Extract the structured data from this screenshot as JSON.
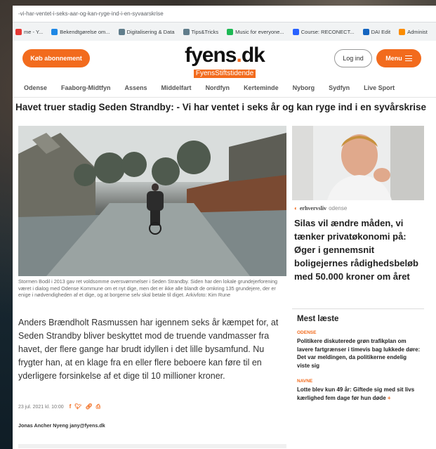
{
  "browser": {
    "url": "-vi-har-ventet-i-seks-aar-og-kan-ryge-ind-i-en-syvaarskrise",
    "bookmarks": [
      {
        "label": "me - Y...",
        "color": "#e53935"
      },
      {
        "label": "Bekendtgørelse om...",
        "color": "#1e88e5"
      },
      {
        "label": "Digitalisering & Data",
        "color": "#607d8b"
      },
      {
        "label": "Tips&Tricks",
        "color": "#607d8b"
      },
      {
        "label": "Music for everyone...",
        "color": "#1db954"
      },
      {
        "label": "Course: RECONECT...",
        "color": "#2962ff"
      },
      {
        "label": "DAI Edit",
        "color": "#1565c0"
      },
      {
        "label": "Administ",
        "color": "#fb8c00"
      }
    ]
  },
  "header": {
    "subscribe_label": "Køb abonnement",
    "logo_main": "fyens",
    "logo_dot": ".",
    "logo_tld": "dk",
    "logo_sub": "FyensStiftstidende",
    "login_label": "Log ind",
    "menu_label": "Menu"
  },
  "nav": [
    "Odense",
    "Faaborg-Midtfyn",
    "Assens",
    "Middelfart",
    "Nordfyn",
    "Kerteminde",
    "Nyborg",
    "Sydfyn",
    "Live Sport"
  ],
  "article": {
    "headline": "Havet truer stadig Seden Strandby: - Vi har ventet i seks år og kan ryge ind i en syvårskrise",
    "caption": "Stormen Bodil i 2013 gav ret voldsomme oversvømmelser i Seden Strandby. Siden har den lokale grundejerforening været i dialog med Odense Kommune om et nyt dige, men det er ikke alle blandt de omkring 135 grundejere, der er enige i nødvendigheden af et dige, og at borgerne selv skal betale til diget. Arkivfoto: Kim Rune",
    "lead": "Anders Brændholt Rasmussen har igennem seks år kæmpet for, at Seden Strandby bliver beskyttet mod de truende vandmasser fra havet, der flere gange har brudt idyllen i det lille bysamfund. Nu frygter han, at en klage fra en eller flere beboere kan føre til en yderligere forsinkelse af et dige til 10 millioner kroner.",
    "date": "23 jul. 2021 kl. 10:00",
    "byline": "Jonas Ancher Nyeng jany@fyens.dk"
  },
  "sidebar": {
    "partner_brand": "erhvervsliv",
    "partner_location": "odense",
    "title": "Silas vil ændre måden, vi tænker privatøkonomi på: Øger i gennemsnit boligejernes rådighedsbeløb med 50.000 kroner om året",
    "most_read_title": "Mest læste",
    "most_read": [
      {
        "category": "ODENSE",
        "text": "Politikere diskuterede grøn trafikplan om lavere fartgrænser i timevis bag lukkede døre: Det var meldingen, da politikerne endelig viste sig",
        "plus": ""
      },
      {
        "category": "NAVNE",
        "text": "Lotte blev kun 49 år: Giftede sig med sit livs kærlighed fem dage før hun døde",
        "plus": "+"
      }
    ]
  },
  "colors": {
    "brand": "#f26b1d"
  }
}
